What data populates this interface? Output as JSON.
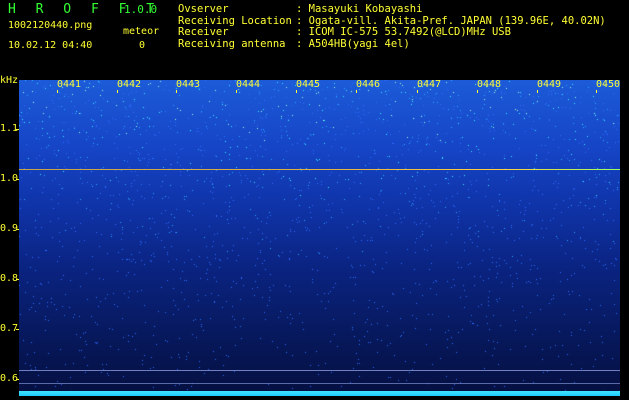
{
  "header": {
    "title": "H R O F F T",
    "version": "1.0.0",
    "filename": "1002120440.png",
    "meteor_label": "meteor",
    "datetime": "10.02.12 04:40",
    "meteor_count": "0"
  },
  "station": [
    {
      "key": "Ovserver",
      "value": ": Masayuki Kobayashi"
    },
    {
      "key": "Receiving Location",
      "value": ": Ogata-vill. Akita-Pref. JAPAN (139.96E, 40.02N)"
    },
    {
      "key": "Receiver",
      "value": ": ICOM IC-575 53.7492(@LCD)MHz USB"
    },
    {
      "key": "Receiving antenna",
      "value": ": A504HB(yagi 4el)"
    }
  ],
  "plot": {
    "unit": "kHz",
    "y_ticks": [
      "1.1",
      "1.0",
      "0.9",
      "0.8",
      "0.7",
      "0.6"
    ],
    "time_labels": [
      "0441",
      "0442",
      "0443",
      "0444",
      "0445",
      "0446",
      "0447",
      "0448",
      "0449",
      "0450"
    ],
    "colors": {
      "text": "#ffff33",
      "title": "#33ff33",
      "trace_1_02": "#e0b040",
      "trace_0_58": "#6f7fbf",
      "baseband": "#3fe6ff"
    }
  }
}
